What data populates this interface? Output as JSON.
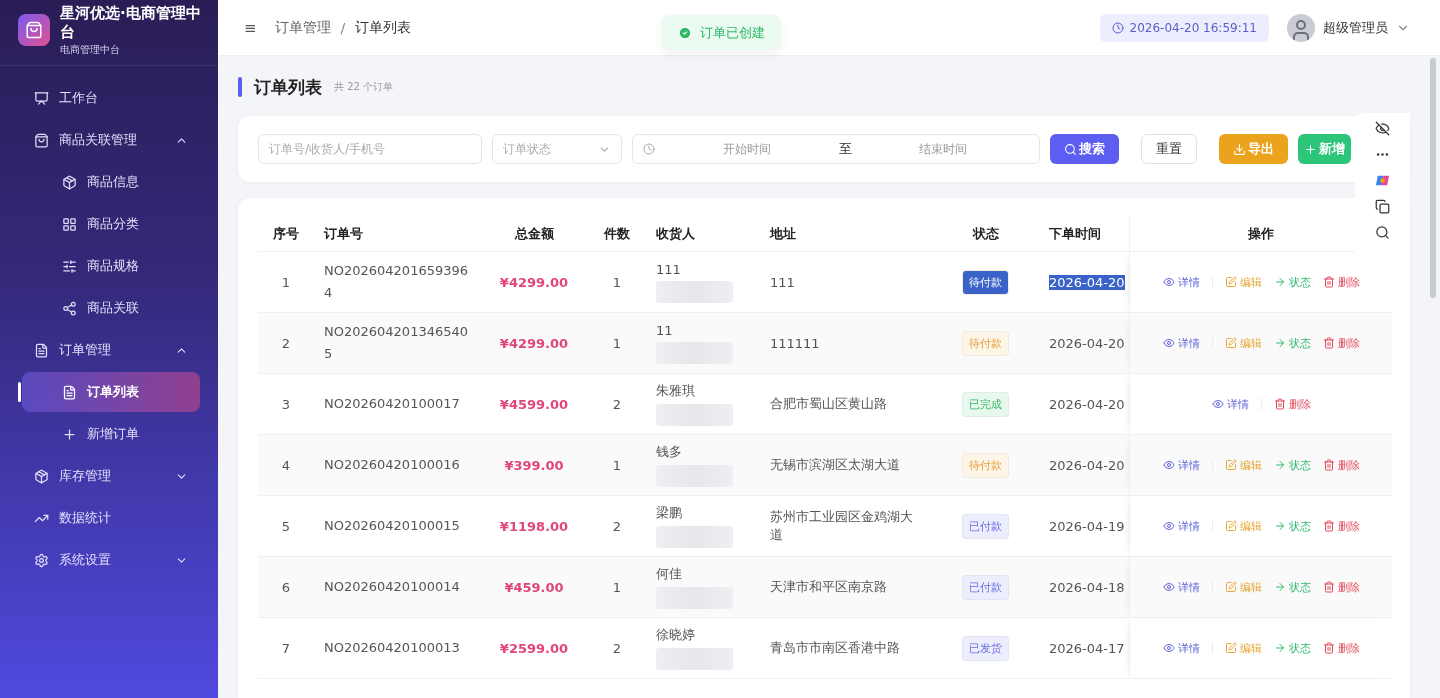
{
  "sidebar": {
    "app_title": "星河优选·电商管理中台",
    "app_subtitle": "电商管理中台",
    "items": [
      {
        "label": "工作台",
        "selected": false
      },
      {
        "label": "商品关联管理",
        "selected": false,
        "expanded": true,
        "children": [
          {
            "label": "商品信息",
            "selected": false
          },
          {
            "label": "商品分类",
            "selected": false
          },
          {
            "label": "商品规格",
            "selected": false
          },
          {
            "label": "商品关联",
            "selected": false
          }
        ]
      },
      {
        "label": "订单管理",
        "selected": false,
        "expanded": true,
        "children": [
          {
            "label": "订单列表",
            "selected": true
          },
          {
            "label": "新增订单",
            "selected": false
          }
        ]
      },
      {
        "label": "库存管理",
        "selected": false,
        "expanded": false
      },
      {
        "label": "数据统计",
        "selected": false
      },
      {
        "label": "系统设置",
        "selected": false,
        "expanded": false
      }
    ]
  },
  "header": {
    "menu_glyph": "≡",
    "breadcrumb": [
      "订单管理",
      "订单列表"
    ],
    "breadcrumb_separator": "/",
    "datetime": "2026-04-20 16:59:11",
    "user_name": "超级管理员"
  },
  "toast": {
    "message": "订单已创建"
  },
  "page": {
    "title": "订单列表",
    "count": "共 22 个订单"
  },
  "filters": {
    "search_placeholder": "订单号/收货人/手机号",
    "status_placeholder": "订单状态",
    "start_placeholder": "开始时间",
    "range_separator": "至",
    "end_placeholder": "结束时间",
    "buttons": [
      {
        "label": "搜索",
        "kind": "search"
      },
      {
        "label": "重置",
        "kind": "reset"
      },
      {
        "label": "导出",
        "kind": "export"
      },
      {
        "label": "新增",
        "kind": "add"
      }
    ]
  },
  "table": {
    "columns": [
      "序号",
      "订单号",
      "总金额",
      "件数",
      "收货人",
      "地址",
      "状态",
      "下单时间",
      "操作"
    ],
    "rows": [
      {
        "index": "1",
        "order_no": "NO2026042016593964",
        "amount": "¥4299.00",
        "qty": "1",
        "receiver": "111",
        "address": "111",
        "status": {
          "label": "待付款",
          "kind": "pending"
        },
        "time": "2026-04-20",
        "text_highlighted": true,
        "actions": [
          {
            "label": "详情",
            "kind": "view"
          },
          {
            "label": "编辑",
            "kind": "edit"
          },
          {
            "label": "状态",
            "kind": "status"
          },
          {
            "label": "删除",
            "kind": "delete"
          }
        ]
      },
      {
        "index": "2",
        "order_no": "NO2026042013465405",
        "amount": "¥4299.00",
        "qty": "1",
        "receiver": "11",
        "address": "111111",
        "status": {
          "label": "待付款",
          "kind": "pending"
        },
        "time": "2026-04-20",
        "text_highlighted": false,
        "actions": [
          {
            "label": "详情",
            "kind": "view"
          },
          {
            "label": "编辑",
            "kind": "edit"
          },
          {
            "label": "状态",
            "kind": "status"
          },
          {
            "label": "删除",
            "kind": "delete"
          }
        ]
      },
      {
        "index": "3",
        "order_no": "NO20260420100017",
        "amount": "¥4599.00",
        "qty": "2",
        "receiver": "朱雅琪",
        "address": "合肥市蜀山区黄山路",
        "status": {
          "label": "已完成",
          "kind": "done"
        },
        "time": "2026-04-20",
        "text_highlighted": false,
        "actions": [
          {
            "label": "详情",
            "kind": "view"
          },
          {
            "label": "删除",
            "kind": "delete"
          }
        ]
      },
      {
        "index": "4",
        "order_no": "NO20260420100016",
        "amount": "¥399.00",
        "qty": "1",
        "receiver": "钱多",
        "address": "无锡市滨湖区太湖大道",
        "status": {
          "label": "待付款",
          "kind": "pending"
        },
        "time": "2026-04-20",
        "text_highlighted": false,
        "actions": [
          {
            "label": "详情",
            "kind": "view"
          },
          {
            "label": "编辑",
            "kind": "edit"
          },
          {
            "label": "状态",
            "kind": "status"
          },
          {
            "label": "删除",
            "kind": "delete"
          }
        ]
      },
      {
        "index": "5",
        "order_no": "NO20260420100015",
        "amount": "¥1198.00",
        "qty": "2",
        "receiver": "梁鹏",
        "address": "苏州市工业园区金鸡湖大道",
        "status": {
          "label": "已付款",
          "kind": "paid"
        },
        "time": "2026-04-19",
        "text_highlighted": false,
        "actions": [
          {
            "label": "详情",
            "kind": "view"
          },
          {
            "label": "编辑",
            "kind": "edit"
          },
          {
            "label": "状态",
            "kind": "status"
          },
          {
            "label": "删除",
            "kind": "delete"
          }
        ]
      },
      {
        "index": "6",
        "order_no": "NO20260420100014",
        "amount": "¥459.00",
        "qty": "1",
        "receiver": "何佳",
        "address": "天津市和平区南京路",
        "status": {
          "label": "已付款",
          "kind": "paid"
        },
        "time": "2026-04-18",
        "text_highlighted": false,
        "actions": [
          {
            "label": "详情",
            "kind": "view"
          },
          {
            "label": "编辑",
            "kind": "edit"
          },
          {
            "label": "状态",
            "kind": "status"
          },
          {
            "label": "删除",
            "kind": "delete"
          }
        ]
      },
      {
        "index": "7",
        "order_no": "NO20260420100013",
        "amount": "¥2599.00",
        "qty": "2",
        "receiver": "徐晓婷",
        "address": "青岛市市南区香港中路",
        "status": {
          "label": "已发货",
          "kind": "shipped"
        },
        "time": "2026-04-17",
        "text_highlighted": false,
        "actions": [
          {
            "label": "详情",
            "kind": "view"
          },
          {
            "label": "编辑",
            "kind": "edit"
          },
          {
            "label": "状态",
            "kind": "status"
          },
          {
            "label": "删除",
            "kind": "delete"
          }
        ]
      }
    ]
  }
}
